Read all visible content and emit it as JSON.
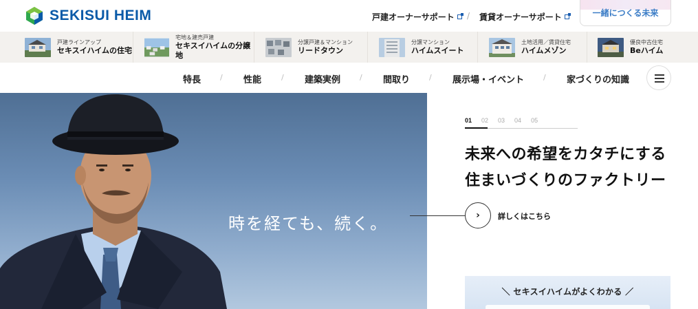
{
  "header": {
    "logo_text": "SEKISUI HEIM",
    "support_owner": "戸建オーナーサポート",
    "support_rental": "賃貸オーナーサポート",
    "future_button": "一緒につくる未来"
  },
  "product_lines": [
    {
      "small": "戸建ラインアップ",
      "big": "セキスイハイムの住宅"
    },
    {
      "small": "宅地＆建売戸建",
      "big": "セキスイハイムの分譲地"
    },
    {
      "small": "分譲戸建＆マンション",
      "big": "リードタウン"
    },
    {
      "small": "分譲マンション",
      "big": "ハイムスイート"
    },
    {
      "small": "土地活用／賃貸住宅",
      "big": "ハイムメゾン"
    },
    {
      "small": "優良中古住宅",
      "big": "Beハイム"
    }
  ],
  "nav": [
    "特長",
    "性能",
    "建築実例",
    "間取り",
    "展示場・イベント",
    "家づくりの知識"
  ],
  "hero": {
    "copy": "時を経ても、続く。",
    "pager": [
      "01",
      "02",
      "03",
      "04",
      "05"
    ],
    "pager_active": 0,
    "headline_1": "未来への希望をカタチにする",
    "headline_2": "住まいづくりのファクトリー",
    "cta": "詳しくはこちら"
  },
  "banner": {
    "title": "＼ セキスイハイムがよくわかる ／"
  },
  "colors": {
    "brand_blue": "#0a5aa8",
    "accent_green": "#2fa84f",
    "strip_bg": "#f3f1ee"
  }
}
